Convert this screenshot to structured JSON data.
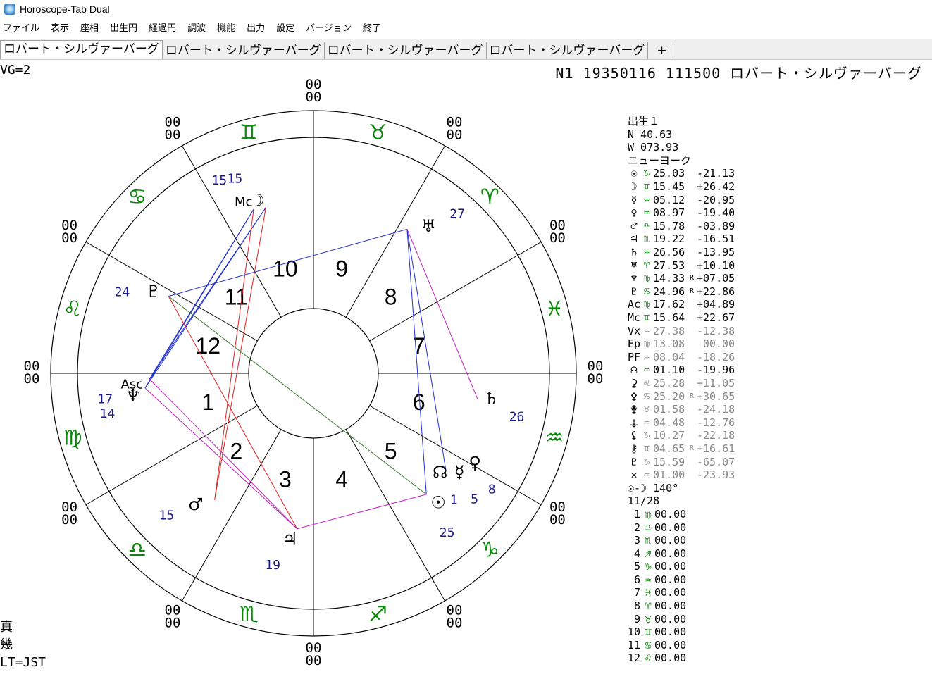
{
  "window": {
    "title": "Horoscope-Tab Dual"
  },
  "menu": [
    "ファイル",
    "表示",
    "座相",
    "出生円",
    "経過円",
    "調波",
    "機能",
    "出力",
    "設定",
    "バージョン",
    "終了"
  ],
  "tabs": [
    "ロバート・シルヴァーバーグ",
    "ロバート・シルヴァーバーグ",
    "ロバート・シルヴァーバーグ",
    "ロバート・シルヴァーバーグ"
  ],
  "tab_add": "+",
  "vg_label": "VG=2",
  "chart_header": "N1 19350116 111500 ロバート・シルヴァーバーグ",
  "footer": [
    "真",
    "幾",
    "LT=JST"
  ],
  "colors": {
    "sign_glyph": "#0a8a0a",
    "blue_aspect": "#2030d0",
    "red_aspect": "#e02020",
    "magenta_aspect": "#c020c0",
    "green_aspect": "#3a7a2a",
    "minor_text": "#888888",
    "number_text": "#1a1a8a"
  },
  "wheel": {
    "rim_marks": [
      "00 00",
      "00 00",
      "00 00",
      "00 00",
      "00 00",
      "00 00",
      "00 00",
      "00 00",
      "00 00",
      "00 00",
      "00 00",
      "00 00"
    ],
    "signs": [
      "♈",
      "♉",
      "♊",
      "♋",
      "♌",
      "♍",
      "♎",
      "♏",
      "♐",
      "♑",
      "♒",
      "♓"
    ],
    "house_numbers": [
      "1",
      "2",
      "3",
      "4",
      "5",
      "6",
      "7",
      "8",
      "9",
      "10",
      "11",
      "12"
    ],
    "planets": [
      {
        "name": "sun",
        "glyph": "☉",
        "deg": "25"
      },
      {
        "name": "moon",
        "glyph": "☽",
        "deg": "15"
      },
      {
        "name": "mercury",
        "glyph": "☿",
        "deg": "5"
      },
      {
        "name": "venus",
        "glyph": "♀",
        "deg": "8"
      },
      {
        "name": "mars",
        "glyph": "♂",
        "deg": "15"
      },
      {
        "name": "jupiter",
        "glyph": "♃",
        "deg": "19"
      },
      {
        "name": "saturn",
        "glyph": "♄",
        "deg": "26"
      },
      {
        "name": "uranus",
        "glyph": "♅",
        "deg": "27"
      },
      {
        "name": "neptune",
        "glyph": "♆",
        "deg": "14"
      },
      {
        "name": "pluto",
        "glyph": "♇",
        "deg": "24"
      },
      {
        "name": "asc",
        "glyph": "Asc",
        "deg": "17"
      },
      {
        "name": "mc",
        "glyph": "Mc",
        "deg": "15"
      },
      {
        "name": "node",
        "glyph": "☊",
        "deg": "1"
      }
    ]
  },
  "panel": {
    "heading": "出生１",
    "lat": "N  40.63",
    "lon": "W 073.93",
    "place": "ニューヨーク",
    "planets": [
      {
        "sym": "☉",
        "sign": "♑",
        "pos": "25.03",
        "r": "",
        "dec": "-21.13",
        "minor": false
      },
      {
        "sym": "☽",
        "sign": "♊",
        "pos": "15.45",
        "r": "",
        "dec": "+26.42",
        "minor": false
      },
      {
        "sym": "☿",
        "sign": "♒",
        "pos": "05.12",
        "r": "",
        "dec": "-20.95",
        "minor": false
      },
      {
        "sym": "♀",
        "sign": "♒",
        "pos": "08.97",
        "r": "",
        "dec": "-19.40",
        "minor": false
      },
      {
        "sym": "♂",
        "sign": "♎",
        "pos": "15.78",
        "r": "",
        "dec": "-03.89",
        "minor": false
      },
      {
        "sym": "♃",
        "sign": "♏",
        "pos": "19.22",
        "r": "",
        "dec": "-16.51",
        "minor": false
      },
      {
        "sym": "♄",
        "sign": "♒",
        "pos": "26.56",
        "r": "",
        "dec": "-13.95",
        "minor": false
      },
      {
        "sym": "♅",
        "sign": "♈",
        "pos": "27.53",
        "r": "",
        "dec": "+10.10",
        "minor": false
      },
      {
        "sym": "♆",
        "sign": "♍",
        "pos": "14.33",
        "r": "R",
        "dec": "+07.05",
        "minor": false
      },
      {
        "sym": "♇",
        "sign": "♋",
        "pos": "24.96",
        "r": "R",
        "dec": "+22.86",
        "minor": false
      },
      {
        "sym": "Ac",
        "sign": "♍",
        "pos": "17.62",
        "r": "",
        "dec": "+04.89",
        "minor": false
      },
      {
        "sym": "Mc",
        "sign": "♊",
        "pos": "15.64",
        "r": "",
        "dec": "+22.67",
        "minor": false
      },
      {
        "sym": "Vx",
        "sign": "♒",
        "pos": "27.38",
        "r": "",
        "dec": "-12.38",
        "minor": true
      },
      {
        "sym": "Ep",
        "sign": "♍",
        "pos": "13.08",
        "r": "",
        "dec": "00.00",
        "minor": true
      },
      {
        "sym": "PF",
        "sign": "♒",
        "pos": "08.04",
        "r": "",
        "dec": "-18.26",
        "minor": true
      },
      {
        "sym": "☊",
        "sign": "♒",
        "pos": "01.10",
        "r": "",
        "dec": "-19.96",
        "minor": false
      },
      {
        "sym": "⚳",
        "sign": "♌",
        "pos": "25.28",
        "r": "",
        "dec": "+11.05",
        "minor": true
      },
      {
        "sym": "⚴",
        "sign": "♋",
        "pos": "25.20",
        "r": "R",
        "dec": "+30.65",
        "minor": true
      },
      {
        "sym": "⚵",
        "sign": "♉",
        "pos": "01.58",
        "r": "",
        "dec": "-24.18",
        "minor": true
      },
      {
        "sym": "⚶",
        "sign": "♒",
        "pos": "04.48",
        "r": "",
        "dec": "-12.76",
        "minor": true
      },
      {
        "sym": "⚸",
        "sign": "♑",
        "pos": "10.27",
        "r": "",
        "dec": "-22.18",
        "minor": true
      },
      {
        "sym": "⚷",
        "sign": "♊",
        "pos": "04.65",
        "r": "R",
        "dec": "+16.61",
        "minor": true
      },
      {
        "sym": "♇",
        "sign": "♑",
        "pos": "15.59",
        "r": "",
        "dec": "-65.07",
        "minor": true
      },
      {
        "sym": "✕",
        "sign": "♒",
        "pos": "01.00",
        "r": "",
        "dec": "-23.93",
        "minor": true
      }
    ],
    "phase": "☉-☽ 140°",
    "phase_day": "11/28",
    "cusps": [
      {
        "n": "1",
        "sign": "♍",
        "pos": "00.00"
      },
      {
        "n": "2",
        "sign": "♎",
        "pos": "00.00"
      },
      {
        "n": "3",
        "sign": "♏",
        "pos": "00.00"
      },
      {
        "n": "4",
        "sign": "♐",
        "pos": "00.00"
      },
      {
        "n": "5",
        "sign": "♑",
        "pos": "00.00"
      },
      {
        "n": "6",
        "sign": "♒",
        "pos": "00.00"
      },
      {
        "n": "7",
        "sign": "♓",
        "pos": "00.00"
      },
      {
        "n": "8",
        "sign": "♈",
        "pos": "00.00"
      },
      {
        "n": "9",
        "sign": "♉",
        "pos": "00.00"
      },
      {
        "n": "10",
        "sign": "♊",
        "pos": "00.00"
      },
      {
        "n": "11",
        "sign": "♋",
        "pos": "00.00"
      },
      {
        "n": "12",
        "sign": "♌",
        "pos": "00.00"
      }
    ]
  }
}
